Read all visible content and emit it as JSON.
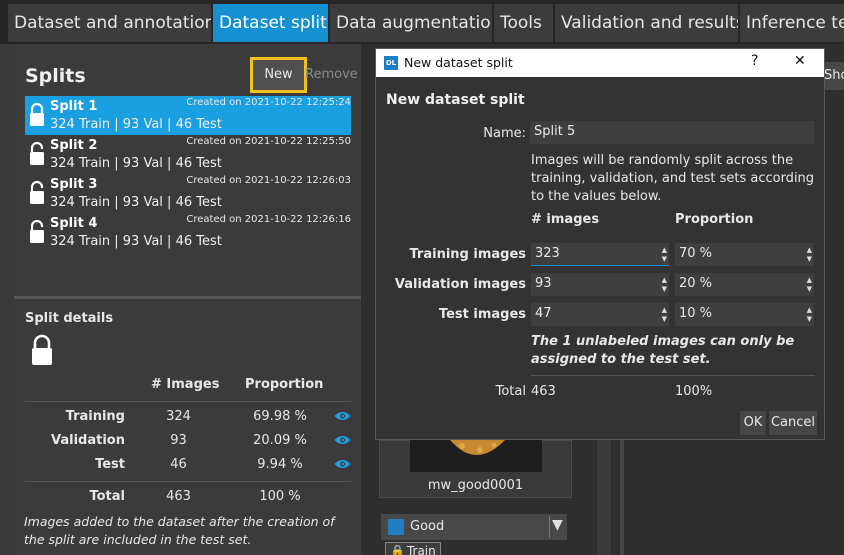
{
  "tabs": [
    {
      "label": "Dataset and annotations"
    },
    {
      "label": "Dataset split"
    },
    {
      "label": "Data augmentation"
    },
    {
      "label": "Tools"
    },
    {
      "label": "Validation and results"
    },
    {
      "label": "Inference tes"
    }
  ],
  "splits_panel": {
    "title": "Splits",
    "new_label": "New",
    "remove_label": "Remove",
    "items": [
      {
        "name": "Split 1",
        "counts": "324 Train | 93 Val | 46 Test",
        "created": "Created on 2021-10-22 12:25:24"
      },
      {
        "name": "Split 2",
        "counts": "324 Train | 93 Val | 46 Test",
        "created": "Created on 2021-10-22 12:25:50"
      },
      {
        "name": "Split 3",
        "counts": "324 Train | 93 Val | 46 Test",
        "created": "Created on 2021-10-22 12:26:03"
      },
      {
        "name": "Split 4",
        "counts": "324 Train | 93 Val | 46 Test",
        "created": "Created on 2021-10-22 12:26:16"
      }
    ]
  },
  "split_details": {
    "title": "Split details",
    "col_images": "# Images",
    "col_proportion": "Proportion",
    "rows": [
      {
        "label": "Training",
        "images": "324",
        "proportion": "69.98 %"
      },
      {
        "label": "Validation",
        "images": "93",
        "proportion": "20.09 %"
      },
      {
        "label": "Test",
        "images": "46",
        "proportion": "9.94 %"
      }
    ],
    "total_label": "Total",
    "total_images": "463",
    "total_proportion": "100 %",
    "note": "Images added to the dataset after the creation of the split are included in the test set."
  },
  "behind": {
    "show_label": "Sho",
    "thumb_name": "mw_good0001",
    "class_label": "Good",
    "train_tag": "Train"
  },
  "dialog": {
    "window_title": "New dataset split",
    "help_glyph": "?",
    "close_glyph": "✕",
    "heading": "New dataset split",
    "name_label": "Name:",
    "name_value": "Split 5",
    "info": "Images will be randomly split across the training, validation, and test sets according to the values below.",
    "col_images": "# images",
    "col_proportion": "Proportion",
    "rows": [
      {
        "label": "Training images",
        "images": "323",
        "proportion": "70 %"
      },
      {
        "label": "Validation images",
        "images": "93",
        "proportion": "20 %"
      },
      {
        "label": "Test images",
        "images": "47",
        "proportion": "10 %"
      }
    ],
    "note_pre": "The ",
    "note_count": "1",
    "note_post": " unlabeled images can only be assigned to the test set.",
    "total_label": "Total",
    "total_images": "463",
    "total_proportion": "100%",
    "ok_label": "OK",
    "cancel_label": "Cancel"
  },
  "colors": {
    "accent": "#1590d0",
    "highlight": "#f3c11b",
    "eye": "#1aa3e8"
  }
}
